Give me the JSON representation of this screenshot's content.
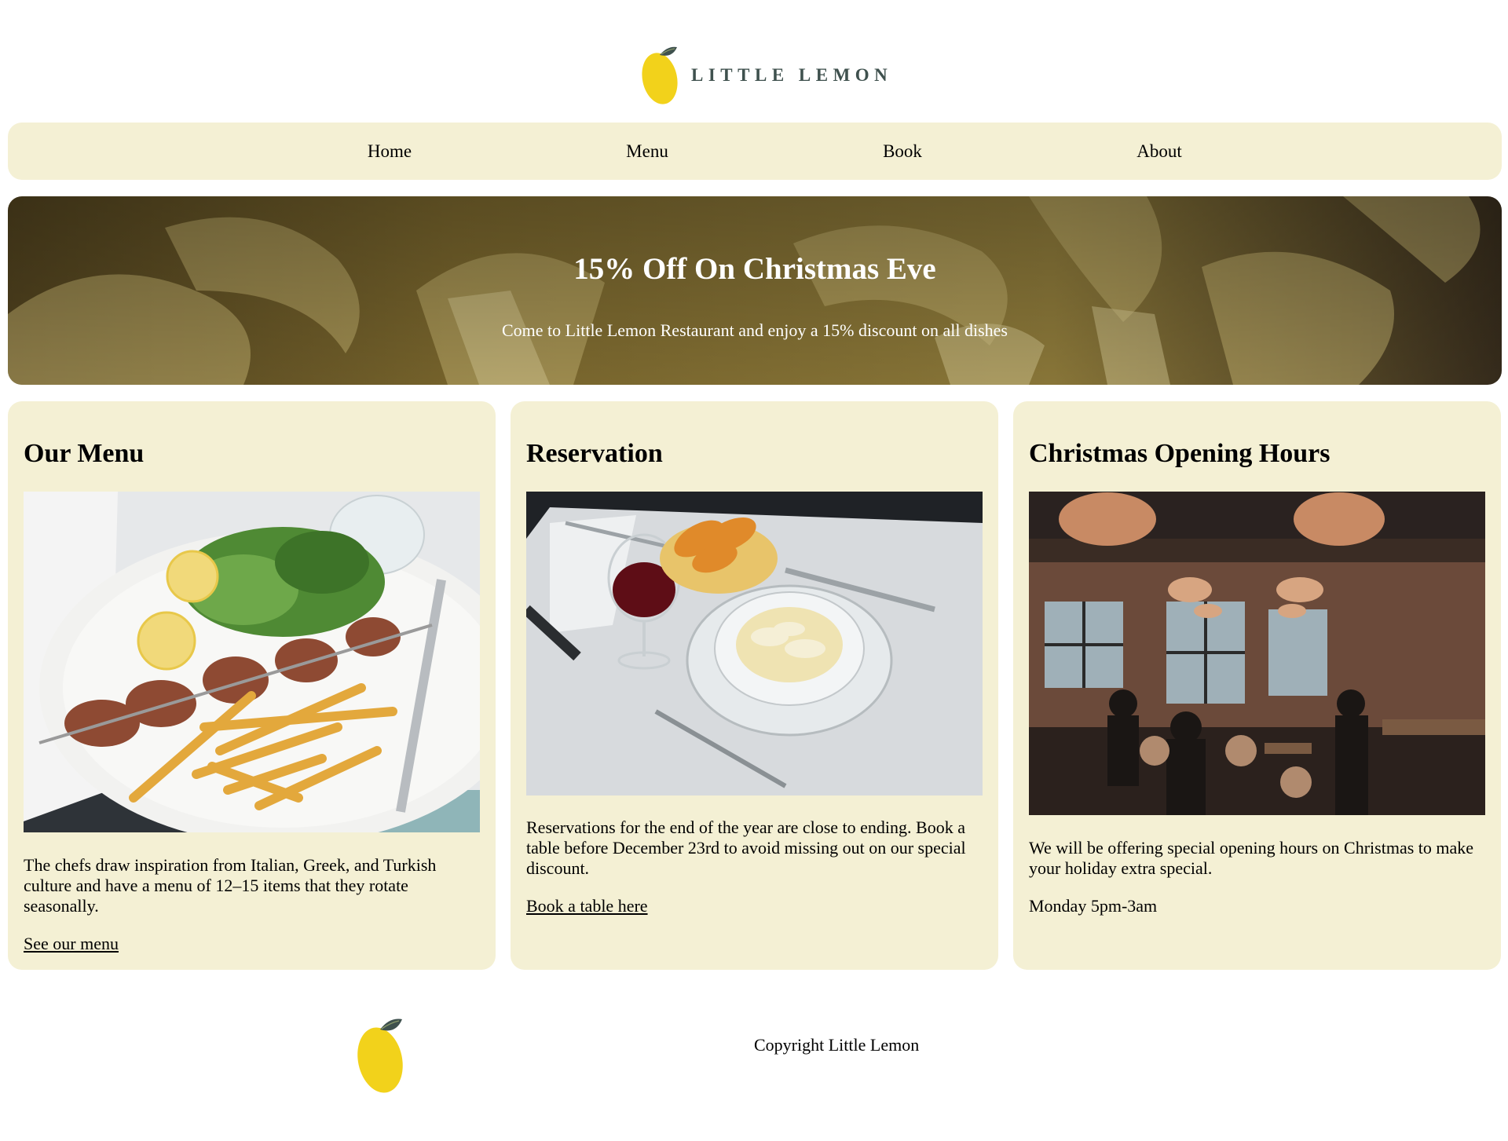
{
  "brand": {
    "name": "LITTLE LEMON",
    "logo_icon": "lemon-icon",
    "lemon_color": "#f2d21b",
    "leaf_color": "#3f514e"
  },
  "nav": {
    "items": [
      {
        "label": "Home"
      },
      {
        "label": "Menu"
      },
      {
        "label": "Book"
      },
      {
        "label": "About"
      }
    ]
  },
  "hero": {
    "title": "15% Off On Christmas Eve",
    "subtitle": "Come to Little Lemon Restaurant and enjoy a 15% discount on all dishes"
  },
  "cards": [
    {
      "title": "Our Menu",
      "image": "plated-skewer-fries-salad-photo",
      "text": "The chefs draw inspiration from Italian, Greek, and Turkish culture and have a menu of 12–15 items that they rotate seasonally.",
      "link": "See our menu"
    },
    {
      "title": "Reservation",
      "image": "table-setting-pasta-wine-photo",
      "text": "Reservations for the end of the year are close to ending. Book a table before December 23rd to avoid missing out on our special discount.",
      "link": "Book a table here"
    },
    {
      "title": "Christmas Opening Hours",
      "image": "restaurant-interior-photo",
      "text": "We will be offering special opening hours on Christmas to make your holiday extra special.",
      "hours": "Monday 5pm-3am"
    }
  ],
  "footer": {
    "copyright": "Copyright Little Lemon",
    "logo_icon": "lemon-icon"
  },
  "colors": {
    "panel": "#f4f0d4",
    "text": "#000000"
  }
}
